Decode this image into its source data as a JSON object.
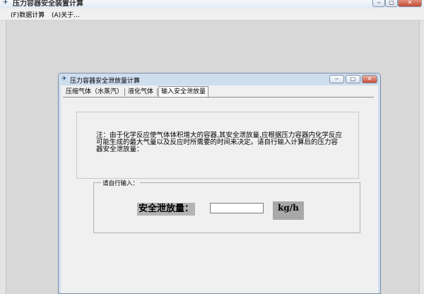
{
  "app": {
    "title": "压力容器安全装置计算"
  },
  "menu": {
    "items": [
      "(F)数据计算",
      "(A)关于..."
    ]
  },
  "child": {
    "title": "压力容器安全泄放量计算",
    "tabs": [
      "压缩气体（水蒸汽）",
      "液化气体",
      "输入安全泄放量"
    ],
    "active_tab": 2,
    "note": "注：由于化学反应使气体体积增大的容器,其安全泄放量,应根据压力容器内化学反应可能生成的最大气量以及反应时所需要的时间来决定。请自行输入计算后的压力容器安全泄放量：",
    "group_label": "请自行输入：",
    "input_label": "安全泄放量：",
    "input_value": "",
    "unit": "kg/h"
  }
}
